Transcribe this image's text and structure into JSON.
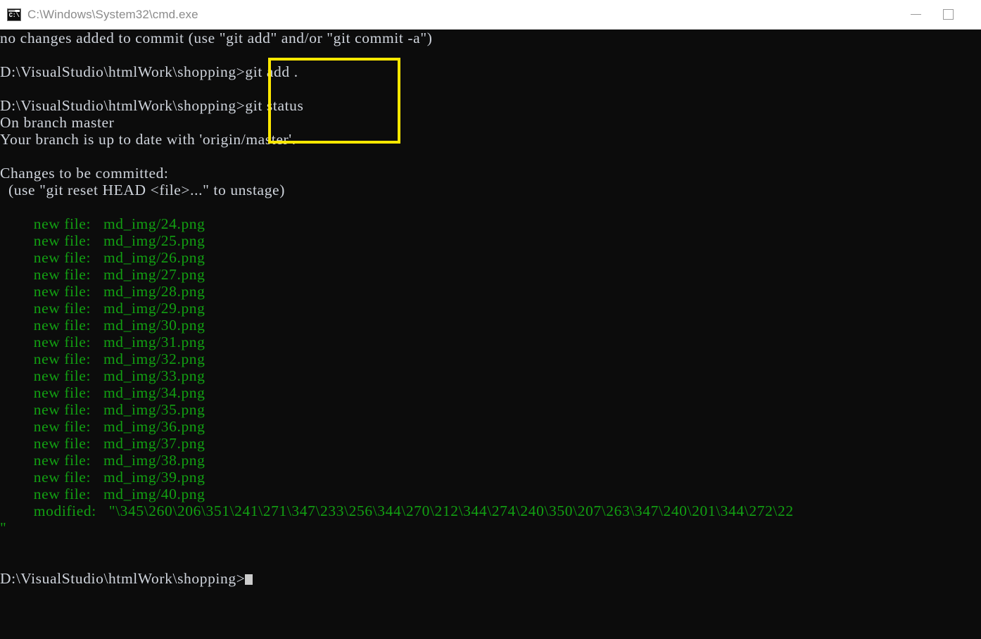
{
  "window": {
    "title": "C:\\Windows\\System32\\cmd.exe",
    "icon_name": "cmd-console-icon",
    "icon_glyph": "C:\\",
    "controls": {
      "minimize_label": "—",
      "maximize_label": "□"
    }
  },
  "annotation": {
    "color": "#ffe800",
    "shape": "rectangle",
    "encloses": "git add . / git status commands"
  },
  "colors": {
    "background": "#0c0c0c",
    "foreground": "#cfd4dc",
    "green": "#12a012",
    "titlebar_bg": "#ffffff",
    "titlebar_fg": "#8b8b8b",
    "highlight": "#ffe800"
  },
  "terminal": {
    "prompt_path": "D:\\VisualStudio\\htmlWork\\shopping>",
    "lines": [
      {
        "id": "l0",
        "text": "no changes added to commit (use \"git add\" and/or \"git commit -a\")",
        "style": "normal"
      },
      {
        "id": "l1",
        "text": "",
        "style": "blank"
      },
      {
        "id": "l2",
        "text": "D:\\VisualStudio\\htmlWork\\shopping>git add .",
        "style": "normal"
      },
      {
        "id": "l3",
        "text": "",
        "style": "blank"
      },
      {
        "id": "l4",
        "text": "D:\\VisualStudio\\htmlWork\\shopping>git status",
        "style": "normal"
      },
      {
        "id": "l5",
        "text": "On branch master",
        "style": "normal"
      },
      {
        "id": "l6",
        "text": "Your branch is up to date with 'origin/master'.",
        "style": "normal"
      },
      {
        "id": "l7",
        "text": "",
        "style": "blank"
      },
      {
        "id": "l8",
        "text": "Changes to be committed:",
        "style": "normal"
      },
      {
        "id": "l9",
        "text": "  (use \"git reset HEAD <file>...\" to unstage)",
        "style": "normal"
      },
      {
        "id": "l10",
        "text": "",
        "style": "blank"
      },
      {
        "id": "l11",
        "text": "        new file:   md_img/24.png",
        "style": "green"
      },
      {
        "id": "l12",
        "text": "        new file:   md_img/25.png",
        "style": "green"
      },
      {
        "id": "l13",
        "text": "        new file:   md_img/26.png",
        "style": "green"
      },
      {
        "id": "l14",
        "text": "        new file:   md_img/27.png",
        "style": "green"
      },
      {
        "id": "l15",
        "text": "        new file:   md_img/28.png",
        "style": "green"
      },
      {
        "id": "l16",
        "text": "        new file:   md_img/29.png",
        "style": "green"
      },
      {
        "id": "l17",
        "text": "        new file:   md_img/30.png",
        "style": "green"
      },
      {
        "id": "l18",
        "text": "        new file:   md_img/31.png",
        "style": "green"
      },
      {
        "id": "l19",
        "text": "        new file:   md_img/32.png",
        "style": "green"
      },
      {
        "id": "l20",
        "text": "        new file:   md_img/33.png",
        "style": "green"
      },
      {
        "id": "l21",
        "text": "        new file:   md_img/34.png",
        "style": "green"
      },
      {
        "id": "l22",
        "text": "        new file:   md_img/35.png",
        "style": "green"
      },
      {
        "id": "l23",
        "text": "        new file:   md_img/36.png",
        "style": "green"
      },
      {
        "id": "l24",
        "text": "        new file:   md_img/37.png",
        "style": "green"
      },
      {
        "id": "l25",
        "text": "        new file:   md_img/38.png",
        "style": "green"
      },
      {
        "id": "l26",
        "text": "        new file:   md_img/39.png",
        "style": "green"
      },
      {
        "id": "l27",
        "text": "        new file:   md_img/40.png",
        "style": "green"
      },
      {
        "id": "l28",
        "text": "        modified:   \"\\345\\260\\206\\351\\241\\271\\347\\233\\256\\344\\270\\212\\344\\274\\240\\350\\207\\263\\347\\240\\201\\344\\272\\22",
        "style": "green"
      },
      {
        "id": "l29",
        "text": "\"",
        "style": "green"
      },
      {
        "id": "l30",
        "text": "",
        "style": "blank"
      },
      {
        "id": "l31",
        "text": "",
        "style": "blank"
      },
      {
        "id": "l32",
        "text": "D:\\VisualStudio\\htmlWork\\shopping>",
        "style": "prompt-cursor"
      }
    ]
  }
}
